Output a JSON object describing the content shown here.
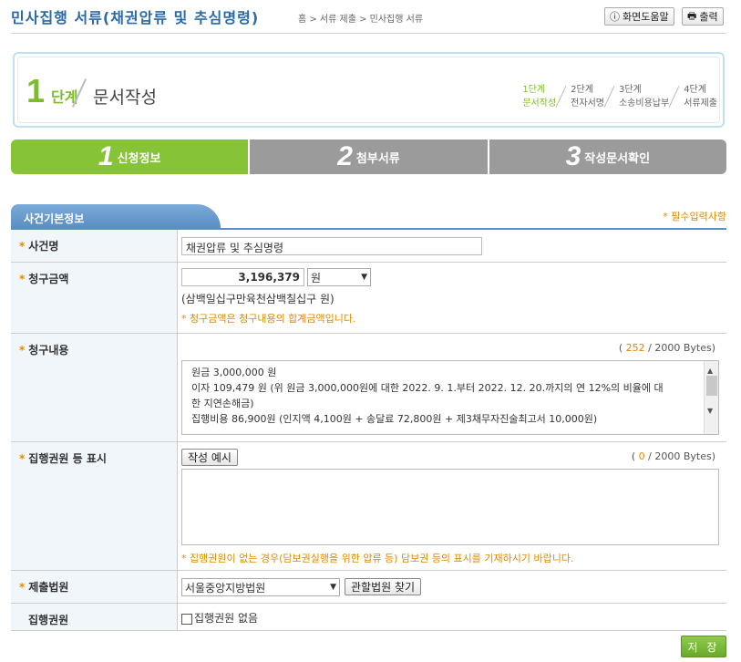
{
  "header": {
    "title": "민사집행 서류(채권압류 및 추심명령)",
    "breadcrumb": "홈 > 서류 제출 > 민사집행 서류",
    "help_label": "화면도움말",
    "print_label": "출력"
  },
  "stage": {
    "number": "1",
    "unit": "단계",
    "name": "문서작성",
    "mini_steps": [
      {
        "num": "1단계",
        "name": "문서작성",
        "active": true
      },
      {
        "num": "2단계",
        "name": "전자서명",
        "active": false
      },
      {
        "num": "3단계",
        "name": "소송비용납부",
        "active": false
      },
      {
        "num": "4단계",
        "name": "서류제출",
        "active": false
      }
    ]
  },
  "tabs": [
    {
      "num": "1",
      "label": "신청정보",
      "active": true
    },
    {
      "num": "2",
      "label": "첨부서류",
      "active": false
    },
    {
      "num": "3",
      "label": "작성문서확인",
      "active": false
    }
  ],
  "section": {
    "title": "사건기본정보",
    "required_note": "* 필수입력사항"
  },
  "form": {
    "case_name": {
      "label": "사건명",
      "value": "채권압류 및 추심명령"
    },
    "claim_amount": {
      "label": "청구금액",
      "value": "3,196,379",
      "unit": "원",
      "korean": "(삼백일십구만육천삼백칠십구 원)",
      "note": "* 청구금액은 청구내용의 합계금액입니다."
    },
    "claim_content": {
      "label": "청구내용",
      "bytes_open": "( ",
      "bytes_count": "252",
      "bytes_total": " / 2000 Bytes)",
      "lines": [
        "원금 3,000,000 원",
        "이자  109,479 원 (위 원금 3,000,000원에 대한 2022. 9. 1.부터 2022. 12. 20.까지의 연 12%의 비율에 대",
        "한 지연손해금)",
        "집행비용 86,900원 (인지액 4,100원 + 송달료 72,800원 + 제3채무자진술최고서 10,000원)"
      ]
    },
    "enforcement_title": {
      "label": "집행권원 등 표시",
      "example_button": "작성 예시",
      "bytes_open": "( ",
      "bytes_count": "0",
      "bytes_total": " / 2000 Bytes)",
      "value": "",
      "note": "* 집행권원이 없는 경우(담보권실행을 위한 압류 등) 담보권 등의 표시를 기재하시기 바랍니다."
    },
    "court": {
      "label": "제출법원",
      "value": "서울중앙지방법원",
      "find_button": "관할법원 찾기"
    },
    "enforcement_right": {
      "label": "집행권원",
      "checkbox_label": "집행권원 없음",
      "checked": false
    }
  },
  "save_label": "저 장"
}
